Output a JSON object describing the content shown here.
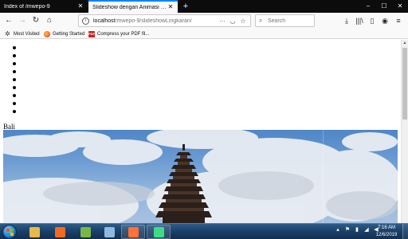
{
  "browser": {
    "tabs": [
      {
        "label": "Index of /mwepo-9",
        "active": false
      },
      {
        "label": "Slideshow dengan Animasi Lingkaran",
        "active": true
      }
    ],
    "new_tab_icon": "plus-icon",
    "window_controls": {
      "minimize": "–",
      "maximize": "☐",
      "close": "✕"
    },
    "nav": {
      "back": "←",
      "forward": "→",
      "reload": "↻",
      "home": "⌂"
    },
    "url": {
      "host": "localhost",
      "path": "/mwepo-9/slideshowLingkaran/"
    },
    "url_actions": {
      "page_actions": "···",
      "pocket": "◡",
      "bookmark": "☆"
    },
    "search": {
      "placeholder": "Search",
      "value": ""
    },
    "toolbar_icons": {
      "downloads": "⤓",
      "library": "|||\\",
      "sidebar": "▯",
      "account": "◉",
      "menu": "≡"
    }
  },
  "bookmarks": [
    {
      "label": "Most Visited",
      "icon": "gear-icon"
    },
    {
      "label": "Getting Started",
      "icon": "firefox-icon"
    },
    {
      "label": "Compress your PDF fil...",
      "icon": "pdf-icon",
      "icon_text": "PDF"
    }
  ],
  "page": {
    "bullet_count": 9,
    "caption": "Bali",
    "image": {
      "subject": "pagoda",
      "colors": {
        "sky": "#4f86c6",
        "cloud": "#e8ecf2",
        "pagoda": "#2b1f1a"
      }
    }
  },
  "taskbar": {
    "apps": [
      {
        "icon": "explorer-icon",
        "color": "#e8b84a",
        "running": false
      },
      {
        "icon": "xampp-icon",
        "color": "#f26a21",
        "running": false
      },
      {
        "icon": "notepadpp-icon",
        "color": "#7ab648",
        "running": false
      },
      {
        "icon": "notepad-icon",
        "color": "#8fb8e0",
        "running": false
      },
      {
        "icon": "firefox-icon",
        "color": "#ff7139",
        "running": true
      },
      {
        "icon": "android-studio-icon",
        "color": "#3ddc84",
        "running": true
      }
    ],
    "time": "7:16 AM",
    "date": "12/6/2019"
  },
  "colors": {
    "tab_accent": "#0a84ff",
    "titlebar": "#0c0c0d",
    "toolbar": "#f9f9fa"
  }
}
